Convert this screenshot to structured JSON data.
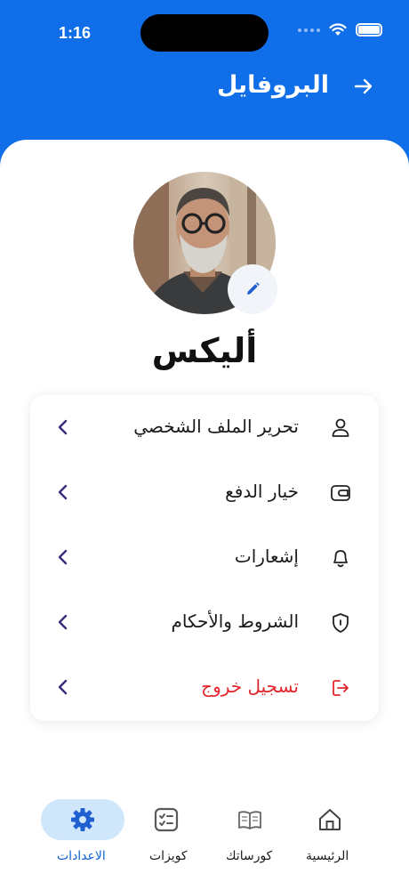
{
  "status_bar": {
    "time": "1:16"
  },
  "header": {
    "title": "البروفايل"
  },
  "profile": {
    "name": "أليكس"
  },
  "menu": {
    "items": [
      {
        "label": "تحرير الملف الشخصي",
        "icon": "user-icon"
      },
      {
        "label": "خيار الدفع",
        "icon": "wallet-icon"
      },
      {
        "label": "إشعارات",
        "icon": "bell-icon"
      },
      {
        "label": "الشروط والأحكام",
        "icon": "shield-icon"
      },
      {
        "label": "تسجيل خروج",
        "icon": "logout-icon",
        "danger": true
      }
    ]
  },
  "tabs": {
    "settings": "الاعدادات",
    "quizzes": "كويزات",
    "courses": "كورساتك",
    "home": "الرئيسية",
    "active": "settings"
  },
  "colors": {
    "primary": "#0f6ee8",
    "danger": "#e3262e",
    "chevron": "#3b2a7a",
    "active_tab_bg": "#cfe6fb"
  }
}
